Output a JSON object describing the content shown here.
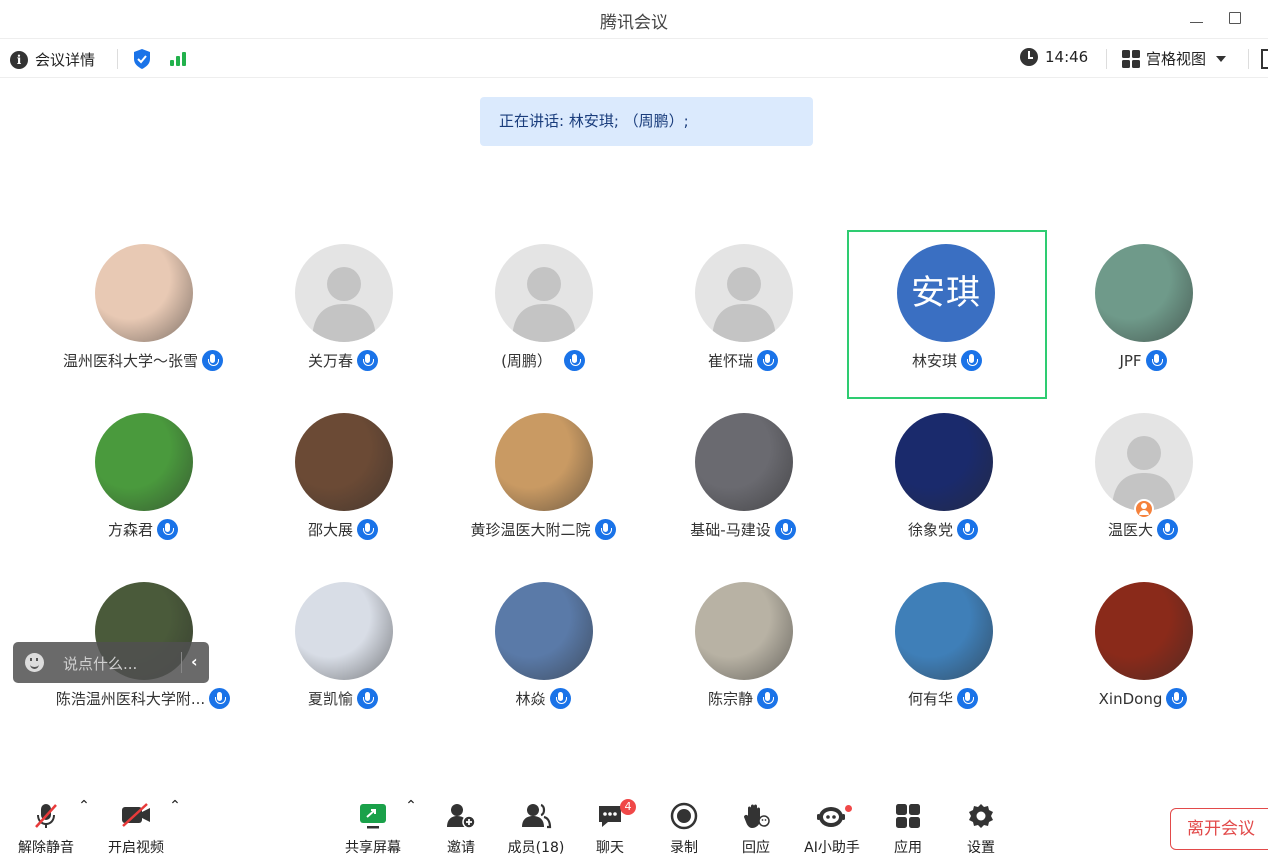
{
  "window": {
    "title": "腾讯会议"
  },
  "infobar": {
    "details_label": "会议详情",
    "time": "14:46",
    "view_label": "宫格视图"
  },
  "speaking": {
    "text": "正在讲话: 林安琪; （周鹏）;"
  },
  "participants": [
    {
      "name": "温州医科大学～张雪",
      "avatar": "photo",
      "color": "#e8c9b4"
    },
    {
      "name": "关万春",
      "avatar": "default"
    },
    {
      "name": "(周鹏）",
      "avatar": "default",
      "mic_plain": true
    },
    {
      "name": "崔怀瑞",
      "avatar": "default"
    },
    {
      "name": "林安琪",
      "avatar": "text",
      "avatar_text": "安琪",
      "active": true
    },
    {
      "name": "JPF",
      "avatar": "photo",
      "color": "#6f9a8a"
    },
    {
      "name": "方森君",
      "avatar": "photo",
      "color": "#4a9a3d"
    },
    {
      "name": "邵大展",
      "avatar": "photo",
      "color": "#6b4a35"
    },
    {
      "name": "黄珍温医大附二院",
      "avatar": "photo",
      "color": "#c99a63"
    },
    {
      "name": "基础-马建设",
      "avatar": "photo",
      "color": "#6a6a70"
    },
    {
      "name": "徐象党",
      "avatar": "photo",
      "color": "#1a2a6c"
    },
    {
      "name": "温医大",
      "avatar": "default",
      "host_badge": true
    },
    {
      "name": "陈浩温州医科大学附...",
      "avatar": "photo",
      "color": "#4a5a3a"
    },
    {
      "name": "夏凯愉",
      "avatar": "photo",
      "color": "#d8dde6"
    },
    {
      "name": "林焱",
      "avatar": "photo",
      "color": "#5a7aa8"
    },
    {
      "name": "陈宗静",
      "avatar": "photo",
      "color": "#b8b2a4"
    },
    {
      "name": "何有华",
      "avatar": "photo",
      "color": "#3f7fb8"
    },
    {
      "name": "XinDong",
      "avatar": "photo",
      "color": "#8a2a1a"
    }
  ],
  "chat": {
    "placeholder": "说点什么..."
  },
  "toolbar": {
    "unmute": "解除静音",
    "start_video": "开启视频",
    "share_screen": "共享屏幕",
    "invite": "邀请",
    "members": "成员(18)",
    "chat": "聊天",
    "chat_badge": "4",
    "record": "录制",
    "reaction": "回应",
    "ai_assistant": "AI小助手",
    "apps": "应用",
    "settings": "设置",
    "leave": "离开会议"
  },
  "colors": {
    "accent": "#1a73e8",
    "active_border": "#2ecc71",
    "signal": "#22b14c",
    "leave": "#e24a4a",
    "speaking_bg": "#dbeafd"
  }
}
